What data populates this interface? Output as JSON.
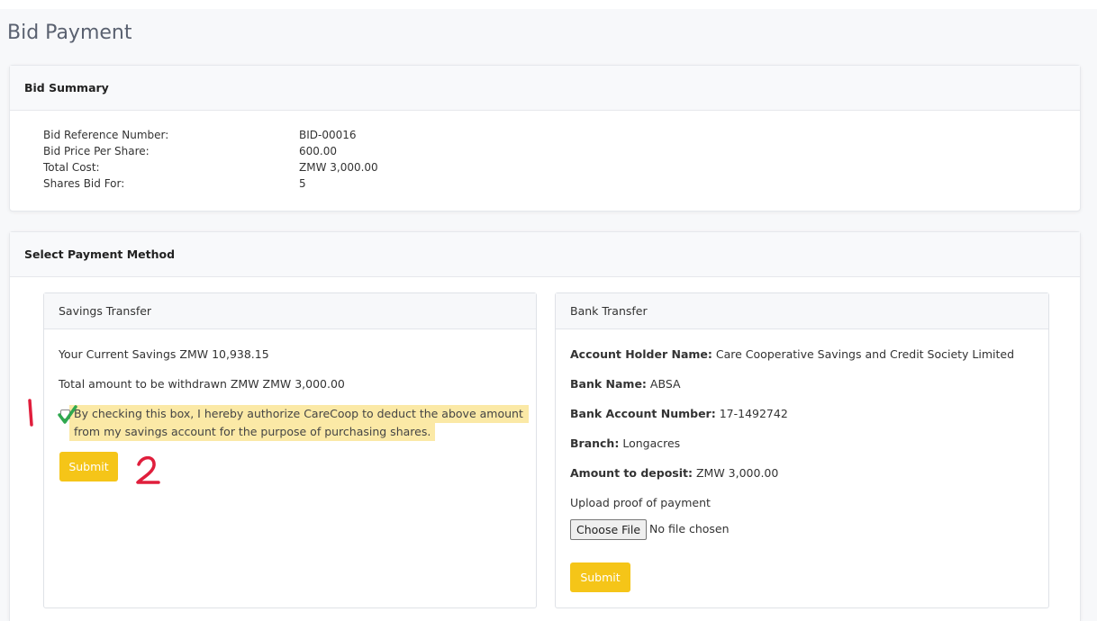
{
  "page": {
    "title": "Bid Payment"
  },
  "bid_summary": {
    "header": "Bid Summary",
    "rows": [
      {
        "label": "Bid Reference Number:",
        "value": "BID-00016"
      },
      {
        "label": "Bid Price Per Share:",
        "value": "600.00"
      },
      {
        "label": "Total Cost:",
        "value": "ZMW 3,000.00"
      },
      {
        "label": "Shares Bid For:",
        "value": "5"
      }
    ]
  },
  "payment": {
    "header": "Select Payment Method",
    "savings": {
      "header": "Savings Transfer",
      "current_savings": "Your Current Savings ZMW 10,938.15",
      "total_withdrawn": "Total amount to be withdrawn ZMW ZMW 3,000.00",
      "authorization_text": "By checking this box, I hereby authorize CareCoop to deduct the above amount from my savings account for the purpose of purchasing shares.",
      "checkbox_checked": false,
      "submit_label": "Submit"
    },
    "bank": {
      "header": "Bank Transfer",
      "account_holder_label": "Account Holder Name:",
      "account_holder_value": "Care Cooperative Savings and Credit Society Limited",
      "bank_name_label": "Bank Name:",
      "bank_name_value": "ABSA",
      "account_number_label": "Bank Account Number:",
      "account_number_value": "17-1492742",
      "branch_label": "Branch:",
      "branch_value": "Longacres",
      "amount_label": "Amount to deposit:",
      "amount_value": "ZMW 3,000.00",
      "upload_label": "Upload proof of payment",
      "choose_file_label": "Choose File",
      "file_status": "No file chosen",
      "submit_label": "Submit"
    }
  },
  "annotations": {
    "step_one": "1",
    "step_two": "2",
    "color": "#e01e3c",
    "check_color": "#2fa84f"
  },
  "colors": {
    "accent_button": "#f5c518",
    "highlight": "#fbe9a6"
  }
}
